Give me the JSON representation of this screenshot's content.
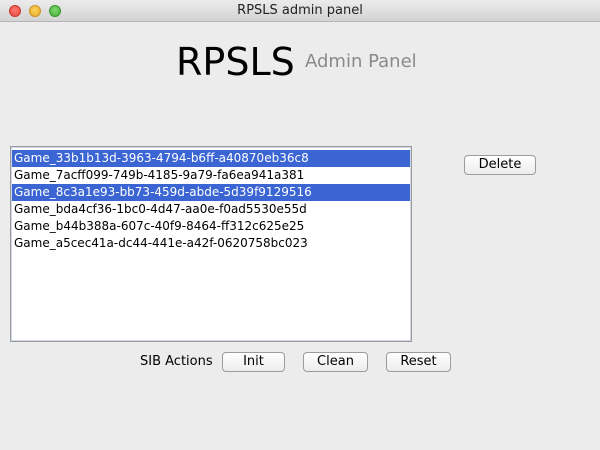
{
  "window": {
    "title": "RPSLS admin panel"
  },
  "header": {
    "title": "RPSLS",
    "subtitle": "Admin Panel"
  },
  "games_list": {
    "items": [
      {
        "label": "Game_33b1b13d-3963-4794-b6ff-a40870eb36c8",
        "selected": true
      },
      {
        "label": "Game_7acff099-749b-4185-9a79-fa6ea941a381",
        "selected": false
      },
      {
        "label": "Game_8c3a1e93-bb73-459d-abde-5d39f9129516",
        "selected": true
      },
      {
        "label": "Game_bda4cf36-1bc0-4d47-aa0e-f0ad5530e55d",
        "selected": false
      },
      {
        "label": "Game_b44b388a-607c-40f9-8464-ff312c625e25",
        "selected": false
      },
      {
        "label": "Game_a5cec41a-dc44-441e-a42f-0620758bc023",
        "selected": false
      }
    ]
  },
  "actions": {
    "delete_label": "Delete",
    "sib_label": "SIB Actions",
    "init_label": "Init",
    "clean_label": "Clean",
    "reset_label": "Reset"
  },
  "colors": {
    "selection": "#3a65d3",
    "subtitle": "#8a8a8a",
    "background": "#ececec"
  }
}
